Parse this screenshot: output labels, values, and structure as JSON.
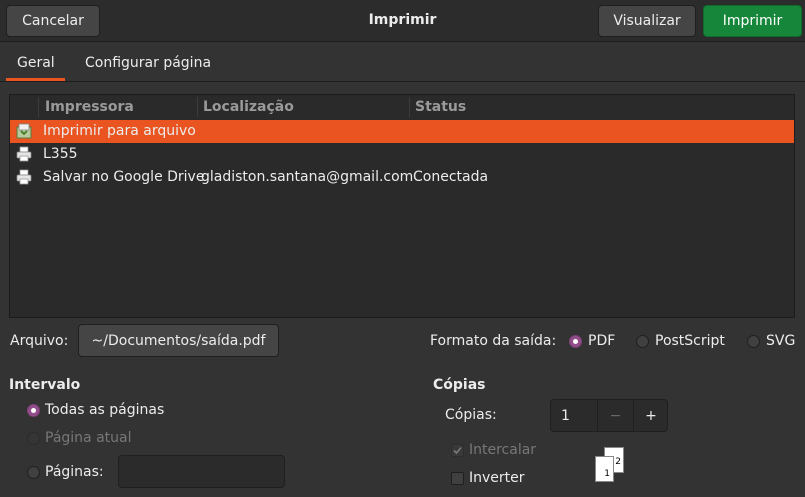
{
  "header": {
    "title": "Imprimir",
    "cancel_label": "Cancelar",
    "preview_label": "Visualizar",
    "print_label": "Imprimir"
  },
  "tabs": [
    {
      "label": "Geral",
      "active": true
    },
    {
      "label": "Configurar página",
      "active": false
    }
  ],
  "printers": {
    "columns": [
      "Impressora",
      "Localização",
      "Status"
    ],
    "rows": [
      {
        "icon": "print-to-file-icon",
        "name": "Imprimir para arquivo",
        "location": "",
        "status": "",
        "selected": true
      },
      {
        "icon": "printer-icon",
        "name": "L355",
        "location": "",
        "status": "",
        "selected": false
      },
      {
        "icon": "printer-icon",
        "name": "Salvar no Google Drive",
        "location": "gladiston.santana@gmail.com",
        "status": "Conectada",
        "selected": false
      }
    ]
  },
  "file": {
    "label": "Arquivo:",
    "value": "~/Documentos/saída.pdf"
  },
  "output_format": {
    "label": "Formato da saída:",
    "options": [
      "PDF",
      "PostScript",
      "SVG"
    ],
    "selected": "PDF"
  },
  "range": {
    "heading": "Intervalo",
    "all_pages": "Todas as páginas",
    "current_page": "Página atual",
    "pages_label": "Páginas:",
    "pages_value": "",
    "selected": "Todas as páginas"
  },
  "copies": {
    "heading": "Cópias",
    "label": "Cópias:",
    "value": "1",
    "decrement": "−",
    "increment": "+",
    "collate_label": "Intercalar",
    "collate_checked": true,
    "reverse_label": "Inverter",
    "reverse_checked": false,
    "preview_pages": [
      "1",
      "2"
    ]
  },
  "colors": {
    "accent": "#e95420",
    "print_button": "#16863a",
    "radio_selected": "#924d8b"
  }
}
